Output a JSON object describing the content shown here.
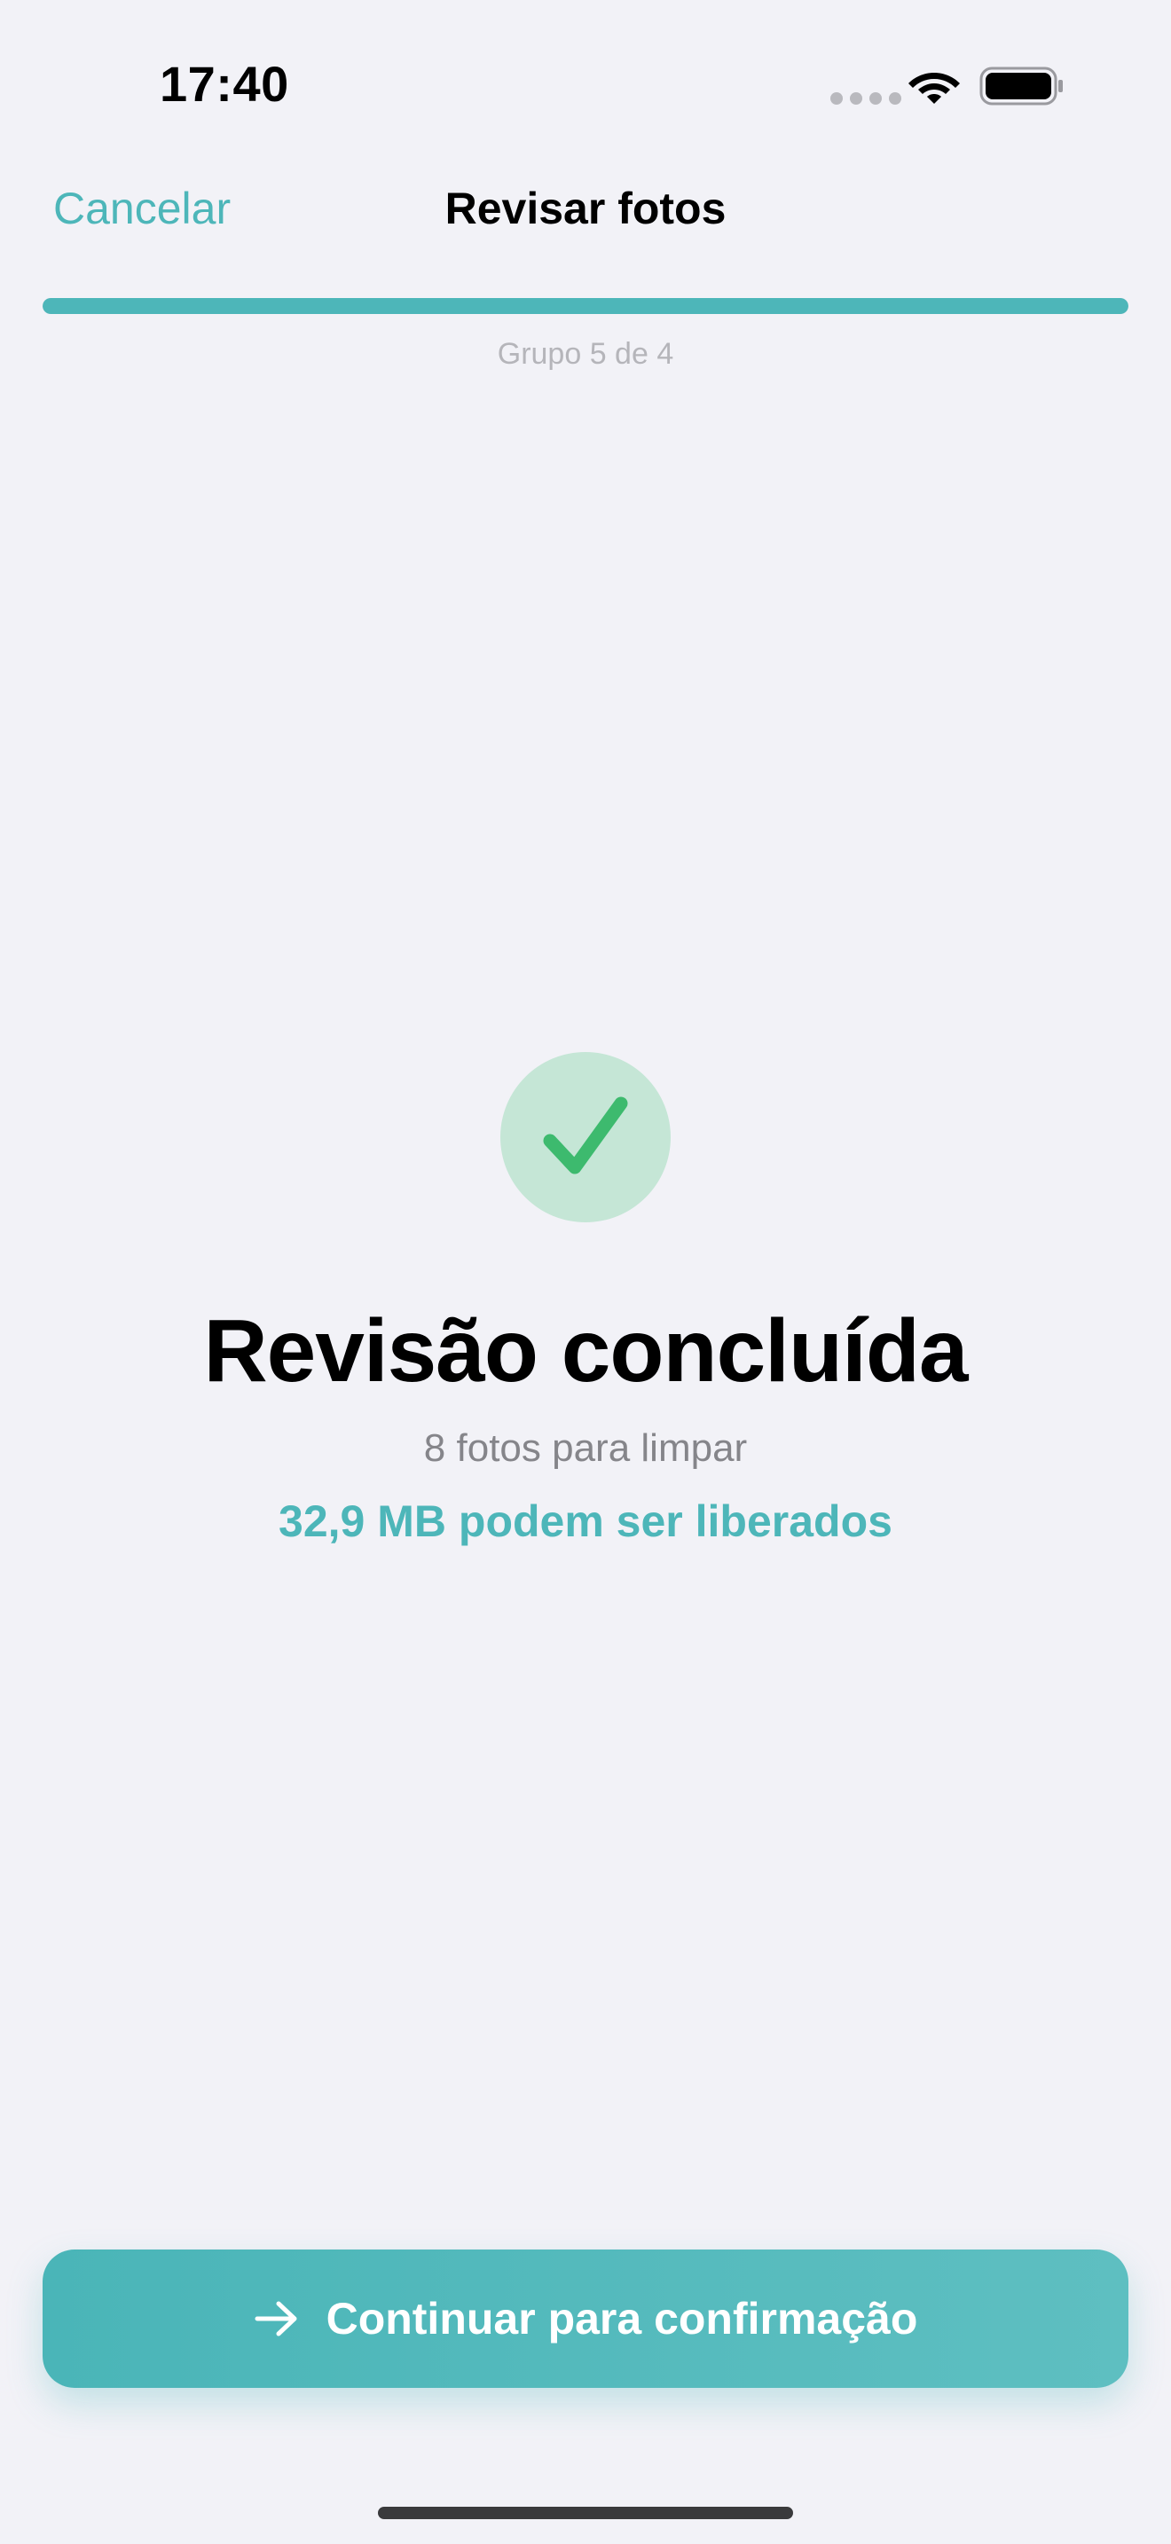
{
  "status_bar": {
    "time": "17:40",
    "icons": [
      "signal-dots-icon",
      "wifi-icon",
      "battery-icon"
    ]
  },
  "nav": {
    "cancel_label": "Cancelar",
    "title": "Revisar fotos"
  },
  "progress": {
    "fraction": 1.0,
    "label": "Grupo 5 de 4"
  },
  "result": {
    "icon": "checkmark-icon",
    "title": "Revisão concluída",
    "photo_count_text": "8 fotos para limpar",
    "free_space_text": "32,9 MB podem ser liberados"
  },
  "actions": {
    "continue_label": "Continuar para confirmação",
    "continue_icon": "arrow-right-icon"
  },
  "colors": {
    "accent": "#4DB6B9",
    "success": "#3DBA6E",
    "success_bg": "#C5E6D6",
    "background": "#F2F2F7",
    "secondary_text": "#85858A"
  }
}
